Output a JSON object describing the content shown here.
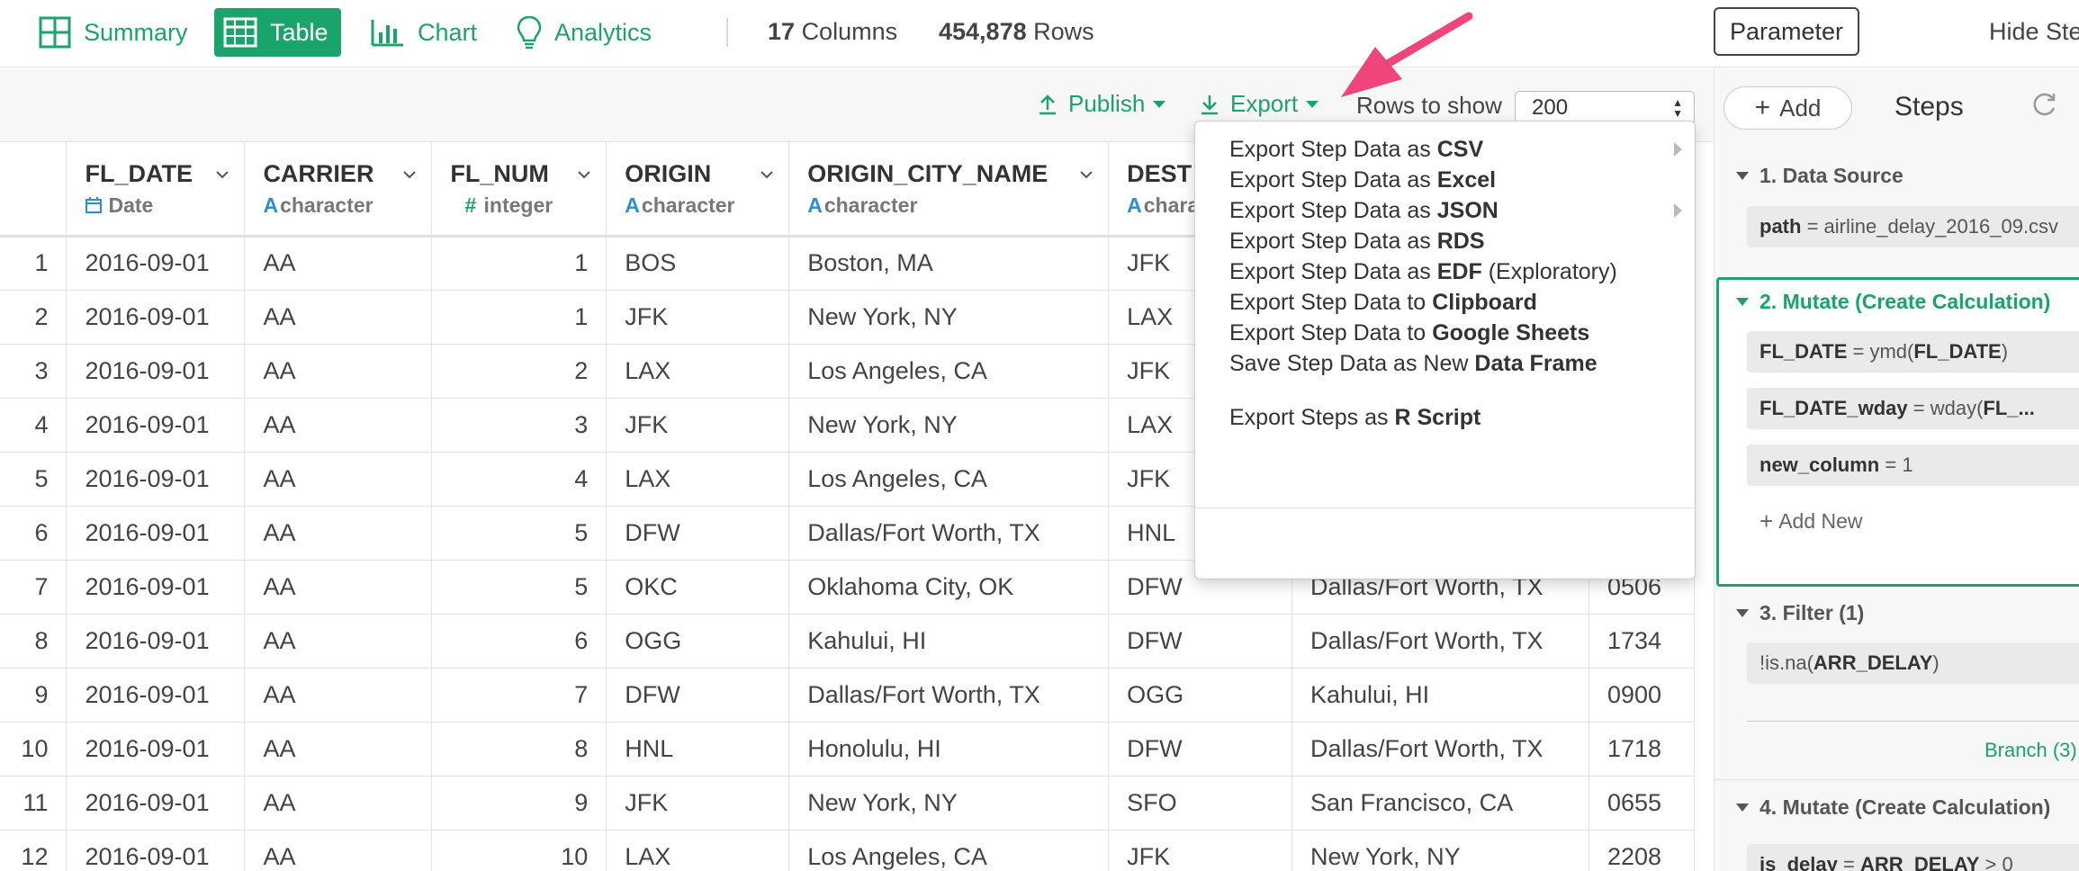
{
  "top_nav": {
    "tabs": [
      {
        "label": "Summary",
        "icon": "summary-grid-icon"
      },
      {
        "label": "Table",
        "icon": "table-icon"
      },
      {
        "label": "Chart",
        "icon": "bar-chart-icon"
      },
      {
        "label": "Analytics",
        "icon": "lightbulb-icon"
      }
    ],
    "columns_count": "17",
    "columns_label": "Columns",
    "rows_count": "454,878",
    "rows_label": "Rows",
    "parameter_label": "Parameter",
    "hide_steps_label": "Hide Steps"
  },
  "toolbar": {
    "publish_label": "Publish",
    "export_label": "Export",
    "rows_to_show_label": "Rows to show",
    "rows_to_show_value": "200"
  },
  "table": {
    "columns": [
      {
        "name": "FL_DATE",
        "type": "Date",
        "type_icon": "calendar-icon"
      },
      {
        "name": "CARRIER",
        "type": "character",
        "type_icon": "A"
      },
      {
        "name": "FL_NUM",
        "type": "integer",
        "type_icon": "#"
      },
      {
        "name": "ORIGIN",
        "type": "character",
        "type_icon": "A"
      },
      {
        "name": "ORIGIN_CITY_NAME",
        "type": "character",
        "type_icon": "A"
      },
      {
        "name": "DEST",
        "type": "chara",
        "type_icon": "A"
      },
      {
        "name": "",
        "type": "",
        "type_icon": ""
      },
      {
        "name": "",
        "type": "",
        "type_icon": ""
      }
    ],
    "rows": [
      [
        "1",
        "2016-09-01",
        "AA",
        "1",
        "BOS",
        "Boston, MA",
        "JFK",
        "",
        ""
      ],
      [
        "2",
        "2016-09-01",
        "AA",
        "1",
        "JFK",
        "New York, NY",
        "LAX",
        "",
        ""
      ],
      [
        "3",
        "2016-09-01",
        "AA",
        "2",
        "LAX",
        "Los Angeles, CA",
        "JFK",
        "",
        ""
      ],
      [
        "4",
        "2016-09-01",
        "AA",
        "3",
        "JFK",
        "New York, NY",
        "LAX",
        "",
        ""
      ],
      [
        "5",
        "2016-09-01",
        "AA",
        "4",
        "LAX",
        "Los Angeles, CA",
        "JFK",
        "",
        ""
      ],
      [
        "6",
        "2016-09-01",
        "AA",
        "5",
        "DFW",
        "Dallas/Fort Worth, TX",
        "HNL",
        "",
        ""
      ],
      [
        "7",
        "2016-09-01",
        "AA",
        "5",
        "OKC",
        "Oklahoma City, OK",
        "DFW",
        "Dallas/Fort Worth, TX",
        "0506"
      ],
      [
        "8",
        "2016-09-01",
        "AA",
        "6",
        "OGG",
        "Kahului, HI",
        "DFW",
        "Dallas/Fort Worth, TX",
        "1734"
      ],
      [
        "9",
        "2016-09-01",
        "AA",
        "7",
        "DFW",
        "Dallas/Fort Worth, TX",
        "OGG",
        "Kahului, HI",
        "0900"
      ],
      [
        "10",
        "2016-09-01",
        "AA",
        "8",
        "HNL",
        "Honolulu, HI",
        "DFW",
        "Dallas/Fort Worth, TX",
        "1718"
      ],
      [
        "11",
        "2016-09-01",
        "AA",
        "9",
        "JFK",
        "New York, NY",
        "SFO",
        "San Francisco, CA",
        "0655"
      ],
      [
        "12",
        "2016-09-01",
        "AA",
        "10",
        "LAX",
        "Los Angeles, CA",
        "JFK",
        "New York, NY",
        "2208"
      ]
    ]
  },
  "export_menu": {
    "items": [
      {
        "prefix": "Export Step Data as",
        "bold": "CSV",
        "suffix": "",
        "submenu": true
      },
      {
        "prefix": "Export Step Data as",
        "bold": "Excel",
        "suffix": "",
        "submenu": false
      },
      {
        "prefix": "Export Step Data as",
        "bold": "JSON",
        "suffix": "",
        "submenu": true
      },
      {
        "prefix": "Export Step Data as",
        "bold": "RDS",
        "suffix": "",
        "submenu": false
      },
      {
        "prefix": "Export Step Data as",
        "bold": "EDF",
        "suffix": "(Exploratory)",
        "submenu": false
      },
      {
        "prefix": "Export Step Data to",
        "bold": "Clipboard",
        "suffix": "",
        "submenu": false
      },
      {
        "prefix": "Export Step Data to",
        "bold": "Google Sheets",
        "suffix": "",
        "submenu": false
      },
      {
        "prefix": "Save Step Data as New",
        "bold": "Data Frame",
        "suffix": "",
        "submenu": false
      },
      {
        "prefix": "Export Steps as",
        "bold": "R Script",
        "suffix": "",
        "submenu": false
      }
    ]
  },
  "steps_panel": {
    "add_label": "Add",
    "title": "Steps",
    "steps": [
      {
        "title": "1. Data Source"
      },
      {
        "title": "2. Mutate (Create Calculation)"
      },
      {
        "title": "3. Filter (1)"
      },
      {
        "title": "4. Mutate (Create Calculation)"
      }
    ],
    "items": {
      "path_key": "path",
      "path_val": "= airline_delay_2016_09.csv",
      "m1_key": "FL_DATE",
      "m1_mid": "= ymd(",
      "m1_arg": "FL_DATE",
      "m1_end": ")",
      "m2_key": "FL_DATE_wday",
      "m2_mid": "= wday(",
      "m2_arg": "FL_...",
      "m3_key": "new_column",
      "m3_val": "= 1",
      "add_new": "Add New",
      "f1_pre": "!is.na(",
      "f1_arg": "ARR_DELAY",
      "f1_end": ")",
      "branch": "Branch (3)",
      "m4_key": "is_delay",
      "m4_mid": "=",
      "m4_arg": "ARR_DELAY",
      "m4_end": "> 0"
    }
  }
}
